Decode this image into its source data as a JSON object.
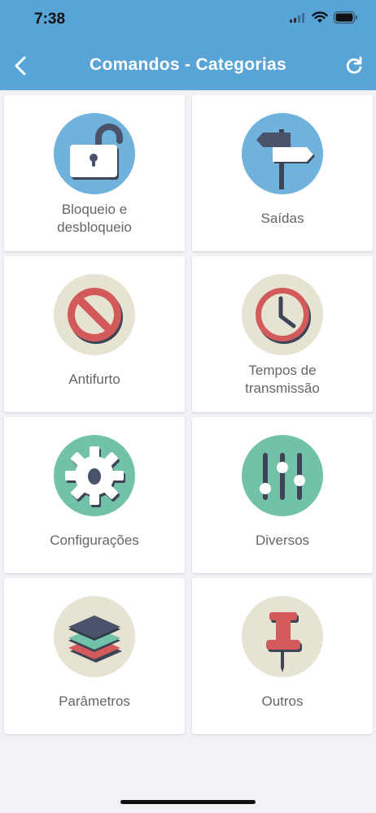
{
  "status_bar": {
    "time": "7:38"
  },
  "nav": {
    "title": "Comandos - Categorias"
  },
  "categories": [
    {
      "label": "Bloqueio e\ndesbloqueio"
    },
    {
      "label": "Saídas"
    },
    {
      "label": "Antifurto"
    },
    {
      "label": "Tempos de\ntransmissão"
    },
    {
      "label": "Configurações"
    },
    {
      "label": "Diversos"
    },
    {
      "label": "Parâmetros"
    },
    {
      "label": "Outros"
    }
  ],
  "colors": {
    "header": "#58a4d6",
    "blue_circle": "#6fb2db",
    "beige_circle": "#e6e3d2",
    "teal_circle": "#72c2aa",
    "red": "#d25a5a",
    "dark": "#4a5369"
  }
}
